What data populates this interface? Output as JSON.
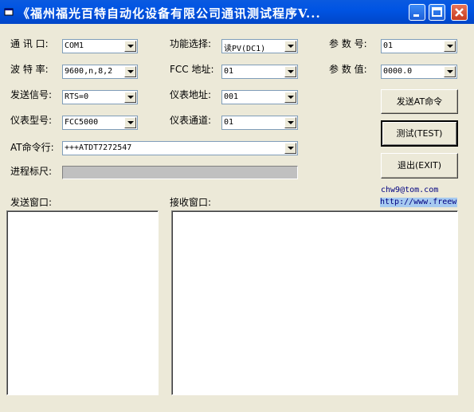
{
  "window": {
    "title": "《福州福光百特自动化设备有限公司通讯测试程序V..."
  },
  "labels": {
    "port": "通 讯 口:",
    "baud": "波 特 率:",
    "send_signal": "发送信号:",
    "meter_model": "仪表型号:",
    "function_select": "功能选择:",
    "fcc_address": "FCC 地址:",
    "meter_address": "仪表地址:",
    "meter_channel": "仪表通道:",
    "param_no": "参 数 号:",
    "param_value": "参 数 值:",
    "at_command_line": "AT命令行:",
    "progress": "进程标尺:",
    "send_window": "发送窗口:",
    "receive_window": "接收窗口:"
  },
  "fields": {
    "port": "COM1",
    "baud": "9600,n,8,2",
    "send_signal": "RTS=0",
    "meter_model": "FCC5000",
    "function_select": "读PV(DC1)",
    "fcc_address": "01",
    "meter_address": "001",
    "meter_channel": "01",
    "param_no": "01",
    "param_value": "0000.0",
    "at_command": "+++ATDT7272547"
  },
  "buttons": {
    "send_at": "发送AT命令",
    "test": "测试(TEST)",
    "exit": "退出(EXIT)"
  },
  "contact": {
    "email": "chw9@tom.com",
    "url": "http://www.freew"
  },
  "progress": {
    "value": 0
  }
}
